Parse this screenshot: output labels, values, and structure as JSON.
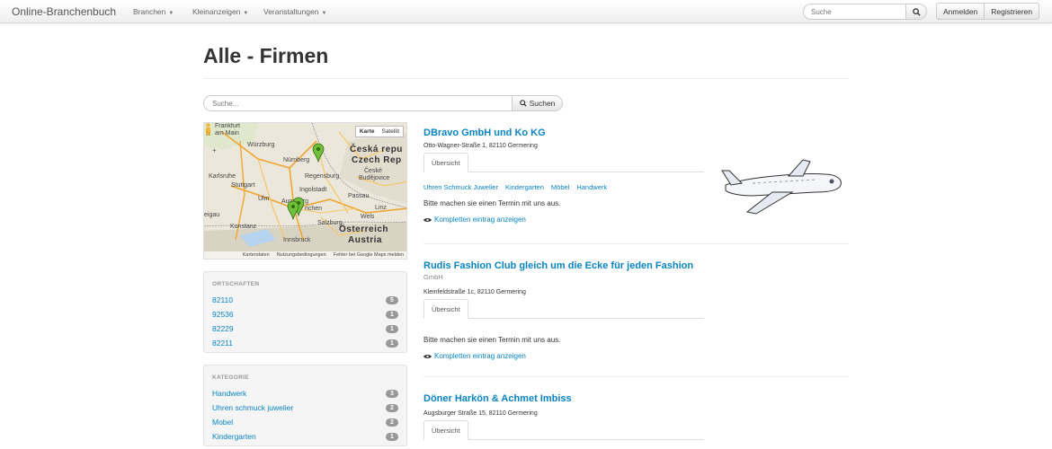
{
  "navbar": {
    "brand": "Online-Branchenbuch",
    "menu": [
      {
        "label": "Branchen"
      },
      {
        "label": "Kleinanzeigen"
      },
      {
        "label": "Veranstaltungen"
      }
    ],
    "search_placeholder": "Suche",
    "login_label": "Anmelden",
    "register_label": "Registrieren"
  },
  "page": {
    "title": "Alle - Firmen",
    "search_placeholder": "Suche...",
    "search_button": "Suchen"
  },
  "map": {
    "type_map": "Karte",
    "type_satellite": "Satellit",
    "labels": [
      {
        "text": "Frankfurt"
      },
      {
        "text": "am Main"
      },
      {
        "text": "Würzburg"
      },
      {
        "text": "Nürnberg"
      },
      {
        "text": "Regensburg"
      },
      {
        "text": "Karlsruhe"
      },
      {
        "text": "Stuttgart"
      },
      {
        "text": "Ulm"
      },
      {
        "text": "Ingolstadt"
      },
      {
        "text": "nchen"
      },
      {
        "text": "Konstanz"
      },
      {
        "text": "Innsbruck"
      },
      {
        "text": "Česká repu"
      },
      {
        "text": "Czech Rep"
      },
      {
        "text": "České"
      },
      {
        "text": "Budějovice"
      },
      {
        "text": "Linz"
      },
      {
        "text": "Wels"
      },
      {
        "text": "eigau"
      },
      {
        "text": "Salzburg"
      },
      {
        "text": "Österreich"
      },
      {
        "text": "Austria"
      },
      {
        "text": "Passau"
      },
      {
        "text": "Augsburg"
      }
    ],
    "footer": [
      "Kartendaten",
      "Nutzungsbedingungen",
      "Fehler bei Google Maps melden"
    ],
    "zoom_in": "+",
    "zoom_out": "−"
  },
  "sidebar": {
    "ortschaften": {
      "header": "ORTSCHAFTEN",
      "items": [
        {
          "label": "82110",
          "count": "5"
        },
        {
          "label": "92536",
          "count": "1"
        },
        {
          "label": "82229",
          "count": "1"
        },
        {
          "label": "82211",
          "count": "1"
        }
      ]
    },
    "kategorie": {
      "header": "KATEGORIE",
      "items": [
        {
          "label": "Handwerk",
          "count": "3"
        },
        {
          "label": "Uhren schmuck juwelier",
          "count": "2"
        },
        {
          "label": "Mobel",
          "count": "2"
        },
        {
          "label": "Kindergarten",
          "count": "1"
        }
      ]
    }
  },
  "listings": [
    {
      "title": "DBravo GmbH und Ko KG",
      "address": "Otto-Wagner-Straße 1, 82110 Germering",
      "tab": "Übersicht",
      "tags": [
        "Uhren Schmuck Juwelier",
        "Kindergarten",
        "Möbel",
        "Handwerk"
      ],
      "description": "Bitte machen sie einen Termin mit uns aus.",
      "more": "Kompletten eintrag anzeigen",
      "image_icon": "airplane-icon"
    },
    {
      "title": "Rudis Fashion Club gleich um die Ecke für jeden Fashion",
      "subtitle": "GmbH",
      "address": "Kleinfeldstraße 1c, 82110 Germering",
      "tab": "Übersicht",
      "description": "Bitte machen sie einen Termin mit uns aus.",
      "more": "Kompletten eintrag anzeigen"
    },
    {
      "title": "Döner Harkön & Achmet Imbiss",
      "address": "Augsburger Straße 15, 82110 Germering",
      "tab": "Übersicht"
    }
  ],
  "colors": {
    "link": "#0a84c1",
    "badge": "#999999",
    "marker": "#6fbf3a"
  }
}
